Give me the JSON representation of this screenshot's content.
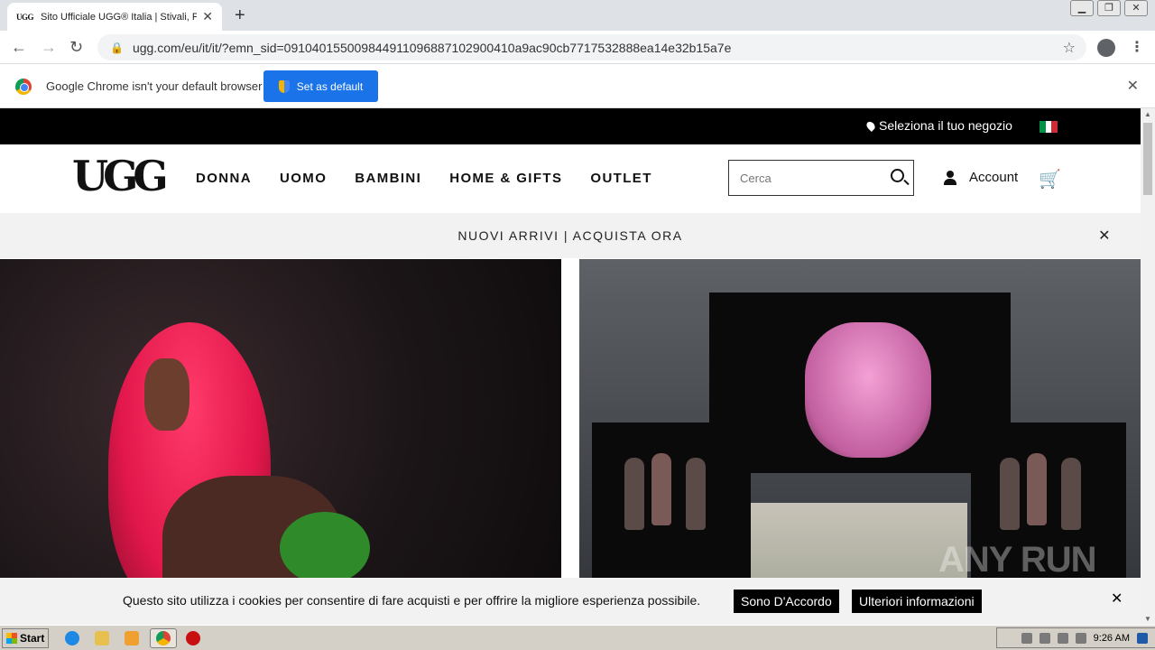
{
  "browser": {
    "tab_title": "Sito Ufficiale UGG® Italia | Stivali, P",
    "tab_favicon_text": "UGG",
    "url": "ugg.com/eu/it/it/?emn_sid=091040155009844911096887102900410a9ac90cb7717532888ea14e32b15a7e",
    "infobar_text": "Google Chrome isn't your default browser",
    "set_default_label": "Set as default"
  },
  "site": {
    "store_label": "Seleziona il tuo negozio",
    "logo_text": "UGG",
    "nav": [
      "DONNA",
      "UOMO",
      "BAMBINI",
      "HOME & GIFTS",
      "OUTLET"
    ],
    "search_placeholder": "Cerca",
    "account_label": "Account",
    "promo_text": "NUOVI ARRIVI | ACQUISTA ORA"
  },
  "cookie": {
    "text": "Questo sito utilizza i cookies per consentire di fare acquisti e per offrire la migliore esperienza possibile.",
    "accept_label": "Sono D'Accordo",
    "more_label": "Ulteriori informazioni"
  },
  "watermark": "ANY RUN",
  "taskbar": {
    "start_label": "Start",
    "clock": "9:26 AM"
  },
  "colors": {
    "chrome_blue": "#1a73e8",
    "flag_green": "#009246",
    "flag_white": "#ffffff",
    "flag_red": "#ce2b37"
  }
}
